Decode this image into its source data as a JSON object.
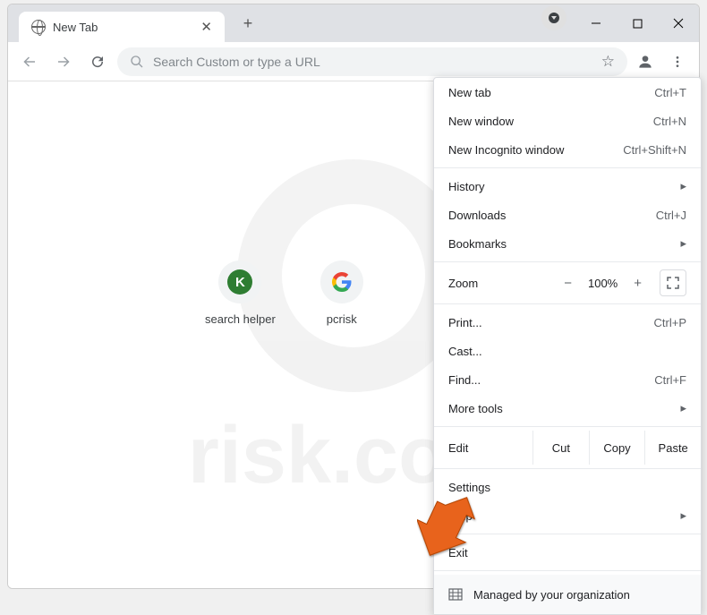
{
  "tab": {
    "title": "New Tab"
  },
  "omnibox": {
    "placeholder": "Search Custom or type a URL"
  },
  "shortcuts": [
    {
      "label": "search helper",
      "icon": "K"
    },
    {
      "label": "pcrisk",
      "icon": "G"
    }
  ],
  "menu": {
    "new_tab": {
      "label": "New tab",
      "shortcut": "Ctrl+T"
    },
    "new_window": {
      "label": "New window",
      "shortcut": "Ctrl+N"
    },
    "new_incognito": {
      "label": "New Incognito window",
      "shortcut": "Ctrl+Shift+N"
    },
    "history": {
      "label": "History"
    },
    "downloads": {
      "label": "Downloads",
      "shortcut": "Ctrl+J"
    },
    "bookmarks": {
      "label": "Bookmarks"
    },
    "zoom": {
      "label": "Zoom",
      "minus": "−",
      "value": "100%",
      "plus": "+"
    },
    "print": {
      "label": "Print...",
      "shortcut": "Ctrl+P"
    },
    "cast": {
      "label": "Cast..."
    },
    "find": {
      "label": "Find...",
      "shortcut": "Ctrl+F"
    },
    "more_tools": {
      "label": "More tools"
    },
    "edit": {
      "label": "Edit",
      "cut": "Cut",
      "copy": "Copy",
      "paste": "Paste"
    },
    "settings": {
      "label": "Settings"
    },
    "help": {
      "label": "Help"
    },
    "exit": {
      "label": "Exit"
    },
    "managed": {
      "label": "Managed by your organization"
    }
  },
  "watermark": "risk.com"
}
